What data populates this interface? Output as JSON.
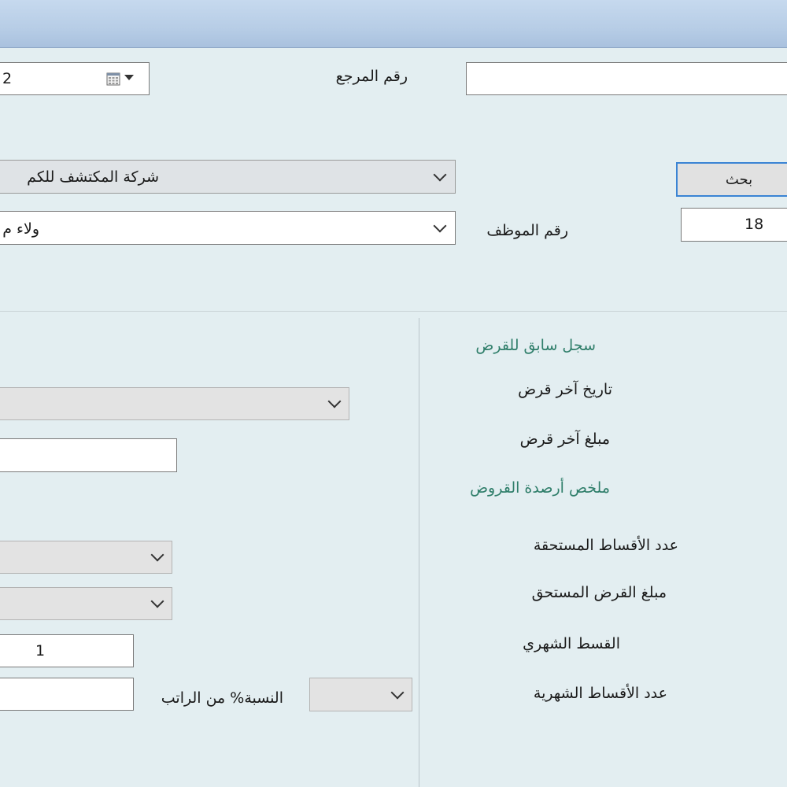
{
  "header": {
    "date_value": "2",
    "ref_label": "رقم المرجع",
    "ref_value": ""
  },
  "company": {
    "selected": "شركة المكتشف للكم"
  },
  "search": {
    "button_label": "بحث",
    "employee_number": "18"
  },
  "employee": {
    "label": "رقم الموظف",
    "selected": "ولاء م"
  },
  "history": {
    "title": "سجل سابق للقرض",
    "last_loan_date_label": "تاريخ آخر قرض",
    "last_loan_amount_label": "مبلغ آخر قرض",
    "summary_title": "ملخص أرصدة القروض",
    "due_installments_label": "عدد الأقساط المستحقة",
    "due_amount_label": "مبلغ القرض المستحق",
    "monthly_installment_label": "القسط الشهري",
    "monthly_installments_count_label": "عدد الأقساط الشهرية"
  },
  "form": {
    "type_selected": "",
    "amount_value": "",
    "option1_selected": "",
    "option2_selected": "",
    "count_value": "1",
    "percent_label": "النسبة% من الراتب",
    "percent_value": "",
    "percent_select": ""
  }
}
